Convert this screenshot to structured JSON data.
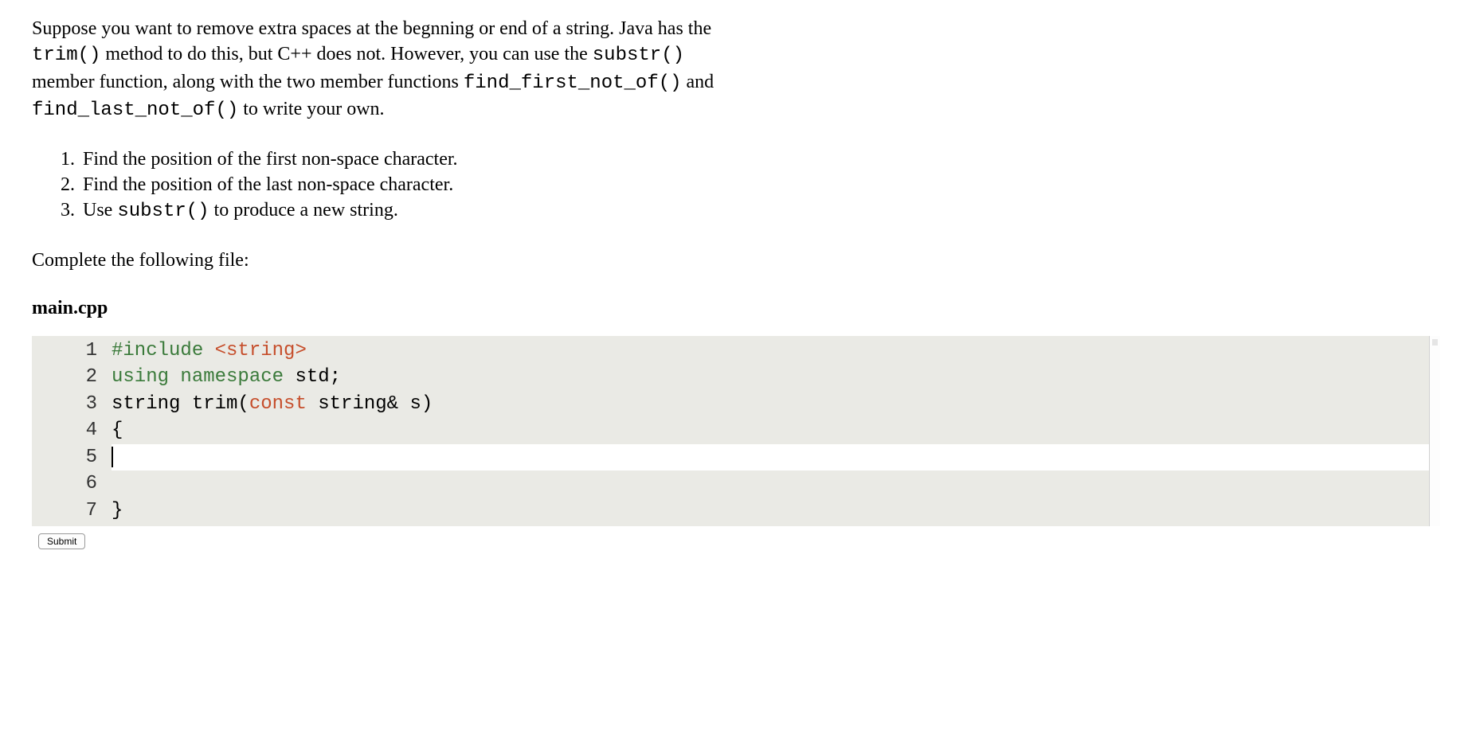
{
  "intro": {
    "part1": "Suppose you want to remove extra spaces at the begnning or end of a string. Java has the ",
    "code1": "trim()",
    "part2": " method to do this, but C++ does not. However, you can use the ",
    "code2": "substr()",
    "part3": " member function, along with the two member functions ",
    "code3": "find_first_not_of()",
    "part4": " and ",
    "code4": "find_last_not_of()",
    "part5": " to write your own."
  },
  "steps": {
    "s1": "Find the position of the first non-space character.",
    "s2": "Find the position of the last non-space character.",
    "s3_prefix": "Use ",
    "s3_code": "substr()",
    "s3_suffix": " to produce a new string."
  },
  "complete_label": "Complete the following file:",
  "filename": "main.cpp",
  "code": {
    "l1a": "#include",
    "l1b": " <string>",
    "l2a": "using",
    "l2b": " ",
    "l2c": "namespace",
    "l2d": " std;",
    "l3a": "string trim(",
    "l3b": "const",
    "l3c": " string& s)",
    "l4": "{",
    "l5": "",
    "l6": "",
    "l7": "}"
  },
  "line_numbers": {
    "n1": "1",
    "n2": "2",
    "n3": "3",
    "n4": "4",
    "n5": "5",
    "n6": "6",
    "n7": "7"
  },
  "submit_label": "Submit"
}
